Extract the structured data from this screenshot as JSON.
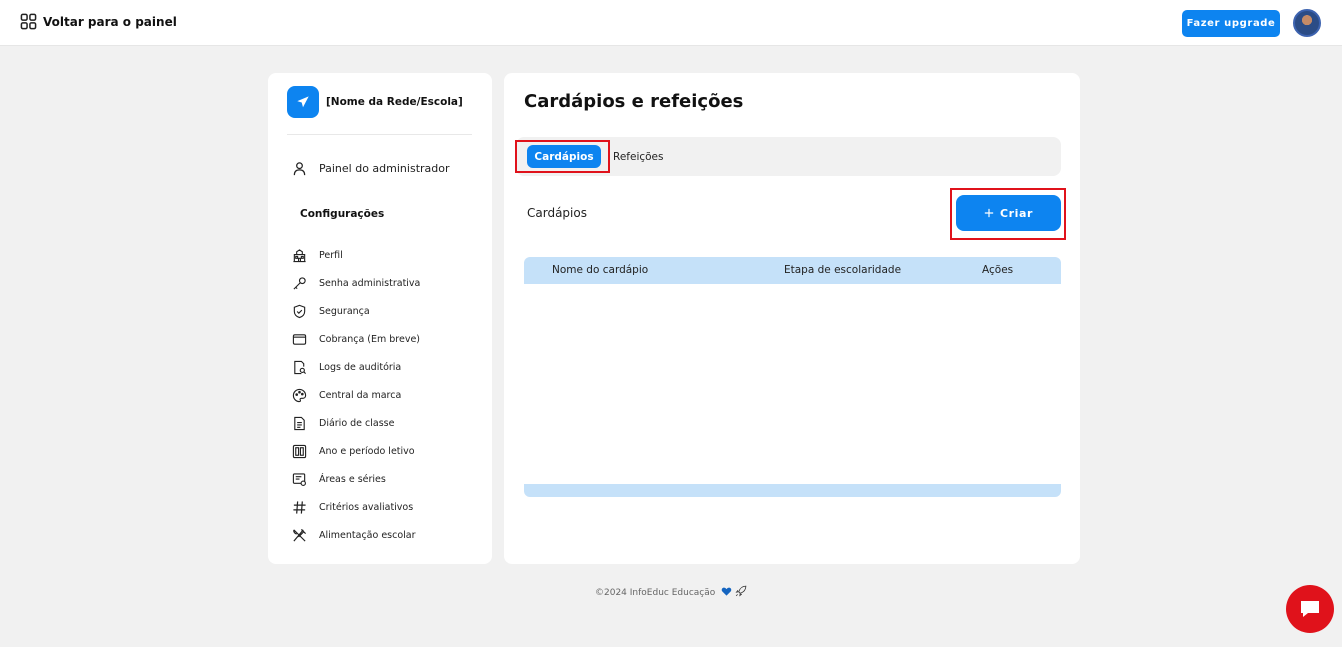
{
  "topbar": {
    "back_label": "Voltar para o painel",
    "upgrade_label": "Fazer upgrade"
  },
  "sidebar": {
    "brand_name": "[Nome da Rede/Escola]",
    "admin_label": "Painel do administrador",
    "config_title": "Configurações",
    "items": [
      {
        "label": "Perfil",
        "icon": "school-building-icon"
      },
      {
        "label": "Senha administrativa",
        "icon": "key-icon"
      },
      {
        "label": "Segurança",
        "icon": "shield-check-icon"
      },
      {
        "label": "Cobrança (Em breve)",
        "icon": "wallet-icon"
      },
      {
        "label": "Logs de auditória",
        "icon": "document-search-icon"
      },
      {
        "label": "Central da marca",
        "icon": "palette-icon"
      },
      {
        "label": "Diário de classe",
        "icon": "file-text-icon"
      },
      {
        "label": "Ano e período letivo",
        "icon": "calendar-grid-icon"
      },
      {
        "label": "Áreas e séries",
        "icon": "list-settings-icon"
      },
      {
        "label": "Critérios avaliativos",
        "icon": "hash-icon"
      },
      {
        "label": "Alimentação escolar",
        "icon": "fork-knife-icon"
      }
    ]
  },
  "main": {
    "title": "Cardápios e refeições",
    "tabs": [
      {
        "label": "Cardápios",
        "active": true
      },
      {
        "label": "Refeições",
        "active": false
      }
    ],
    "section_label": "Cardápios",
    "create_label": "Criar",
    "table": {
      "columns": [
        "Nome do cardápio",
        "Etapa de escolaridade",
        "Ações"
      ],
      "rows": []
    }
  },
  "footer": {
    "text": "©2024 InfoEduc Educação"
  },
  "colors": {
    "accent": "#0d84f0",
    "highlight": "#e0121b",
    "table_header": "#c5e1f9",
    "background": "#f1f1f1"
  }
}
